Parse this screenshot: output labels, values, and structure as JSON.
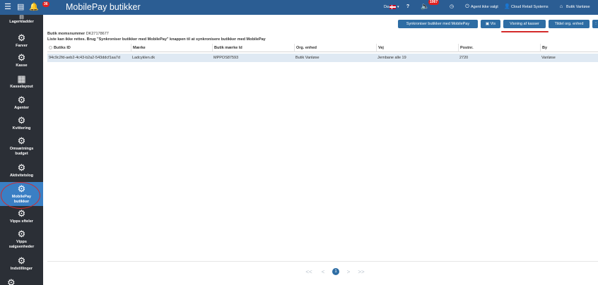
{
  "topbar": {
    "title": "MobilePay butikker",
    "notif_count": "36",
    "lang": "Da",
    "muted_badge": "1067",
    "agent_status": "Agent ikke valgt",
    "company": "Cloud Retail Systems",
    "store": "Butik Vanløse"
  },
  "sidebar": {
    "items": [
      {
        "label": "Lagerkladder",
        "icon": "clipboard-icon"
      },
      {
        "label": "Farver",
        "icon": "gear-icon"
      },
      {
        "label": "Kasse",
        "icon": "gear-icon"
      },
      {
        "label": "Kasselayout",
        "icon": "grid-icon"
      },
      {
        "label": "Agenter",
        "icon": "gear-icon"
      },
      {
        "label": "Kvittering",
        "icon": "gear-icon"
      },
      {
        "label": "Omsætnings budget",
        "icon": "gear-icon"
      },
      {
        "label": "Aktivitetslog",
        "icon": "gear-icon"
      },
      {
        "label": "MobilePay butikker",
        "icon": "gear-icon"
      },
      {
        "label": "Vipps sfteler",
        "icon": "gear-icon"
      },
      {
        "label": "Vipps salgsenheder",
        "icon": "gear-icon"
      },
      {
        "label": "Indstillinger",
        "icon": "gear-icon"
      }
    ]
  },
  "actions": {
    "sync": "Synkroniser butikker med MobilePay",
    "view": "Vis",
    "view_registers": "Visning af kasser",
    "assign_org": "Tildel org. enhed"
  },
  "info": {
    "vat_label": "Butik momsnummer",
    "vat_value": "DK27178677",
    "notice": "Liste kan ikke rettes. Brug \"Synkroniser butikker med MobilePay\" knappen til at synkronisere butikker med MobilePay"
  },
  "table": {
    "columns": [
      "Butiks ID",
      "Mærke",
      "Butik mærke Id",
      "Org. enhed",
      "Vej",
      "Postnr.",
      "By"
    ],
    "rows": [
      [
        "94c9c2fd-aeb2-4c43-b2a2-543ddcf1aa7d",
        "Ladcyklen.dk",
        "MPPOS87593",
        "Butik Vanløse",
        "Jernbane alle 19",
        "2720",
        "Vanløse"
      ]
    ]
  },
  "pager": {
    "first": "<<",
    "prev": "<",
    "current": "1",
    "next": ">",
    "last": ">>"
  },
  "colors": {
    "topbar": "#2b5d93",
    "sidebar": "#2b2f36",
    "active": "#3a7fc4",
    "button": "#2e6da4",
    "row_selected": "#dfe9f3",
    "annotation": "#d42a2a"
  }
}
